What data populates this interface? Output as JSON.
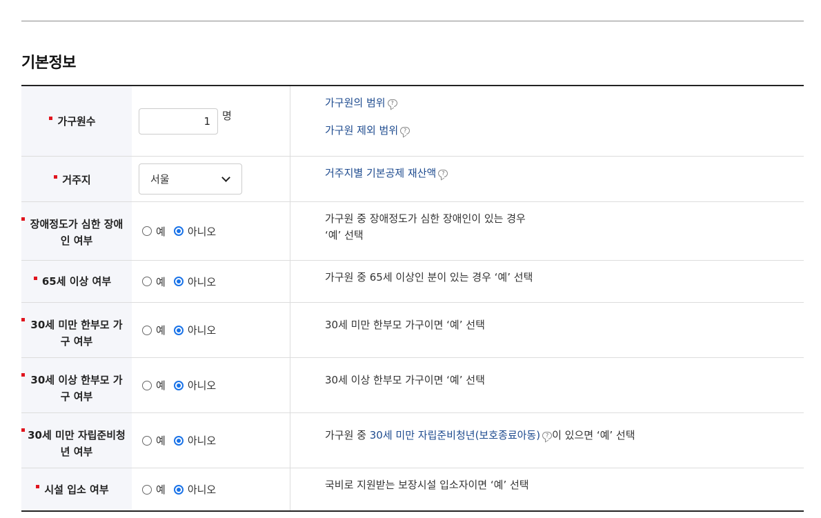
{
  "section_title": "기본정보",
  "rows": [
    {
      "label": "가구원수",
      "value": "1",
      "unit": "명",
      "links": [
        "가구원의 범위",
        "가구원 제외 범위"
      ]
    },
    {
      "label": "거주지",
      "selected": "서울",
      "link": "거주지별 기본공제 재산액"
    },
    {
      "label": "장애정도가 심한 장애인 여부",
      "label_line1": "장애정도가 심한 장애",
      "label_line2": "인 여부",
      "desc_line1": "가구원 중 장애정도가 심한 장애인이 있는 경우",
      "desc_line2": "‘예’ 선택"
    },
    {
      "label": "65세 이상 여부",
      "desc": "가구원 중 65세 이상인 분이 있는 경우 ‘예’ 선택"
    },
    {
      "label_line1": "30세 미만 한부모 가",
      "label_line2": "구 여부",
      "desc": "30세 미만 한부모 가구이면 ‘예’ 선택"
    },
    {
      "label_line1": "30세 이상 한부모 가",
      "label_line2": "구 여부",
      "desc": "30세 이상 한부모 가구이면 ‘예’ 선택"
    },
    {
      "label_line1": "30세 미만 자립준비청",
      "label_line2": "년 여부",
      "desc_prefix": "가구원 중 ",
      "desc_link": "30세 미만 자립준비청년(보호종료아동)",
      "desc_suffix": "이 있으면 ‘예’ 선택"
    },
    {
      "label": "시설 입소 여부",
      "desc": "국비로 지원받는 보장시설 입소자이면 ‘예’ 선택"
    }
  ],
  "radio": {
    "yes": "예",
    "no": "아니오"
  },
  "colors": {
    "accent": "#1a73e8",
    "required": "#e0141e",
    "link": "#1e4b8f",
    "label_bg": "#f5f6fa"
  }
}
